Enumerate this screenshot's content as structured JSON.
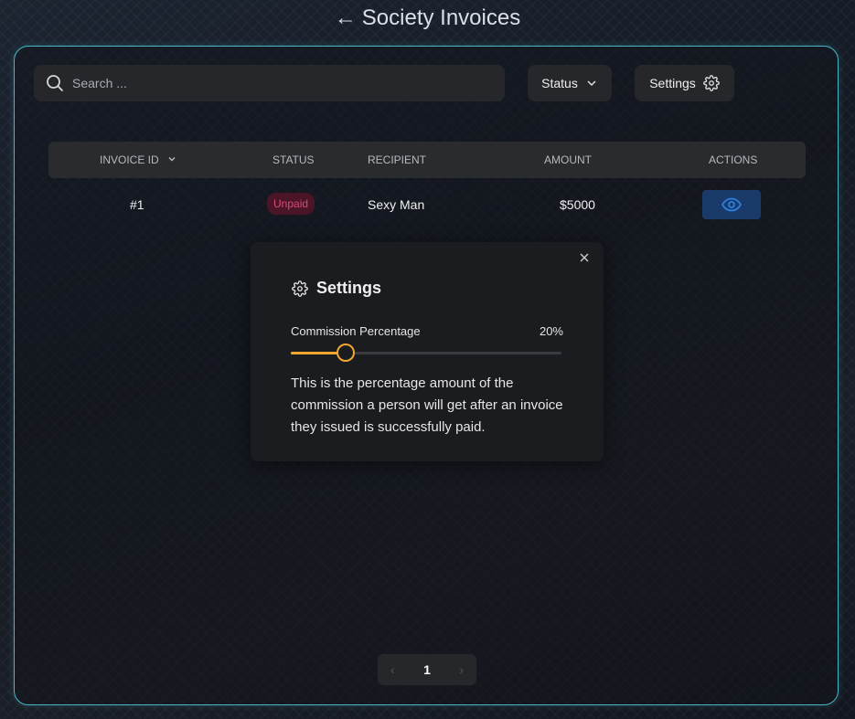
{
  "header": {
    "back_arrow": "←",
    "title": "Society Invoices"
  },
  "toolbar": {
    "search_placeholder": "Search ...",
    "search_icon": "search-icon",
    "status_label": "Status",
    "status_icon": "chevron-down-icon",
    "settings_label": "Settings",
    "settings_icon": "gear-icon"
  },
  "table": {
    "columns": [
      "INVOICE ID",
      "STATUS",
      "RECIPIENT",
      "AMOUNT",
      "ACTIONS"
    ],
    "sort_icon": "chevron-down-icon",
    "rows": [
      {
        "id": "#1",
        "status": "Unpaid",
        "recipient": "Sexy Man",
        "amount": "$5000",
        "action_icon": "eye-icon"
      }
    ]
  },
  "settings_modal": {
    "title": "Settings",
    "close_icon": "close-icon",
    "field_label": "Commission Percentage",
    "field_value": "20%",
    "slider_value": 20,
    "slider_max": 100,
    "description": "This is the percentage amount of the commission a person will get after an invoice they issued is successfully paid."
  },
  "pagination": {
    "prev": "‹",
    "current": "1",
    "next": "›"
  },
  "colors": {
    "accent_border": "#46b6c8",
    "slider": "#f0a830",
    "unpaid_text": "#d94a74",
    "view_button": "#1a3a6a"
  }
}
